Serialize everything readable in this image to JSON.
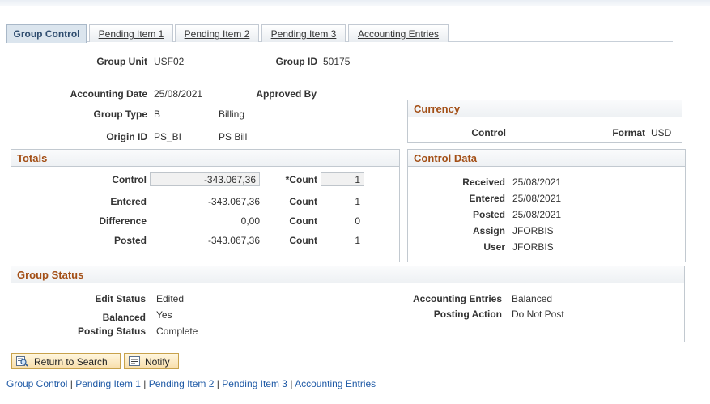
{
  "tabs": [
    {
      "label": "Group Control",
      "active": true
    },
    {
      "label": "Pending Item 1"
    },
    {
      "label": "Pending Item 2"
    },
    {
      "label": "Pending Item 3"
    },
    {
      "label": "Accounting Entries"
    }
  ],
  "header": {
    "group_unit_label": "Group Unit",
    "group_unit_value": "USF02",
    "group_id_label": "Group ID",
    "group_id_value": "50175"
  },
  "info": {
    "accounting_date_label": "Accounting Date",
    "accounting_date_value": "25/08/2021",
    "approved_by_label": "Approved By",
    "group_type_label": "Group Type",
    "group_type_code": "B",
    "group_type_desc": "Billing",
    "origin_id_label": "Origin ID",
    "origin_id_code": "PS_BI",
    "origin_id_desc": "PS Bill"
  },
  "currency": {
    "title": "Currency",
    "control_label": "Control",
    "format_label": "Format",
    "format_value": "USD"
  },
  "totals": {
    "title": "Totals",
    "rows": [
      {
        "label": "Control",
        "amount": "-343.067,36",
        "count_label": "*Count",
        "count": "1"
      },
      {
        "label": "Entered",
        "amount": "-343.067,36",
        "count_label": "Count",
        "count": "1"
      },
      {
        "label": "Difference",
        "amount": "0,00",
        "count_label": "Count",
        "count": "0"
      },
      {
        "label": "Posted",
        "amount": "-343.067,36",
        "count_label": "Count",
        "count": "1"
      }
    ]
  },
  "control_data": {
    "title": "Control Data",
    "rows": [
      {
        "label": "Received",
        "value": "25/08/2021"
      },
      {
        "label": "Entered",
        "value": "25/08/2021"
      },
      {
        "label": "Posted",
        "value": "25/08/2021"
      },
      {
        "label": "Assign",
        "value": "JFORBIS"
      },
      {
        "label": "User",
        "value": "JFORBIS"
      }
    ]
  },
  "group_status": {
    "title": "Group Status",
    "edit_status_label": "Edit Status",
    "edit_status_value": "Edited",
    "balanced_label": "Balanced",
    "balanced_value": "Yes",
    "posting_status_label": "Posting Status",
    "posting_status_value": "Complete",
    "accounting_entries_label": "Accounting Entries",
    "accounting_entries_value": "Balanced",
    "posting_action_label": "Posting Action",
    "posting_action_value": "Do Not Post"
  },
  "buttons": {
    "return_label": "Return to Search",
    "notify_label": "Notify"
  },
  "bottom_links": [
    "Group Control",
    "Pending Item 1",
    "Pending Item 2",
    "Pending Item 3",
    "Accounting Entries"
  ],
  "colors": {
    "section_title": "#a34f16",
    "link": "#1f5aa6",
    "button_border": "#c8a24c"
  }
}
